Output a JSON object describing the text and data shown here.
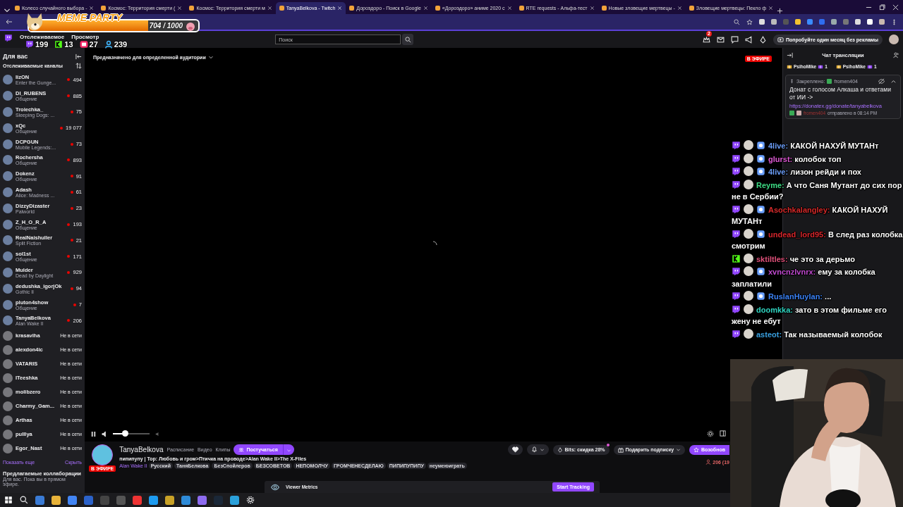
{
  "browser": {
    "tabs": [
      {
        "title": "Колесо случайного выбора -",
        "selected": false
      },
      {
        "title": "Космос: Территория смерти (",
        "selected": false
      },
      {
        "title": "Космос: Территория смерти м",
        "selected": false
      },
      {
        "title": "TanyaBelkova - Twitch",
        "selected": true
      },
      {
        "title": "Дороэдоро - Поиск в Google",
        "selected": false
      },
      {
        "title": "«Дороэдоро» аниме 2020 с",
        "selected": false
      },
      {
        "title": "RTE requests - Альфа-тест",
        "selected": false
      },
      {
        "title": "Новые зловещие мертвецы -",
        "selected": false
      },
      {
        "title": "Зловещие мертвецы: Пекло ф",
        "selected": false
      }
    ]
  },
  "meme_widget": {
    "title": "MEME PARTY",
    "level": 0.704,
    "reading": "704 / 1000"
  },
  "stream_counters": [
    {
      "kind": "twitch",
      "count": "199"
    },
    {
      "kind": "kick",
      "count": "13"
    },
    {
      "kind": "vklive",
      "count": "27"
    },
    {
      "kind": "total",
      "count": "239"
    }
  ],
  "nav": {
    "links": [
      "Отслеживаемое",
      "Просмотр"
    ],
    "search": {
      "placeholder": "Поиск"
    },
    "notification_count": "2",
    "promo_button": "Попробуйте один месяц без рекламы"
  },
  "sidebar": {
    "title": "Для вас",
    "section": "Отслеживаемые каналы",
    "channels": [
      {
        "name": "lizON",
        "game": "Enter the Gunge...",
        "viewers": "494",
        "live": true
      },
      {
        "name": "DI_RUBENS",
        "game": "Общение",
        "viewers": "885",
        "live": true
      },
      {
        "name": "Troiechka_",
        "game": "Sleeping Dogs: ...",
        "viewers": "75",
        "live": true
      },
      {
        "name": "xQc",
        "game": "Общение",
        "viewers": "19 077",
        "live": true
      },
      {
        "name": "DCPGUN",
        "game": "Mobile Legends:...",
        "viewers": "73",
        "live": true
      },
      {
        "name": "Rochersha",
        "game": "Общение",
        "viewers": "893",
        "live": true
      },
      {
        "name": "Dokenz",
        "game": "Общение",
        "viewers": "91",
        "live": true
      },
      {
        "name": "Adash",
        "game": "Alice: Madness ...",
        "viewers": "61",
        "live": true
      },
      {
        "name": "DizzyDizaster",
        "game": "Palworld",
        "viewers": "23",
        "live": true
      },
      {
        "name": "Z_H_O_R_A",
        "game": "Общение",
        "viewers": "193",
        "live": true
      },
      {
        "name": "RealNaishuller",
        "game": "Split Fiction",
        "viewers": "21",
        "live": true
      },
      {
        "name": "sol1st",
        "game": "Общение",
        "viewers": "171",
        "live": true
      },
      {
        "name": "Mulder",
        "game": "Dead by Daylight",
        "viewers": "929",
        "live": true
      },
      {
        "name": "dedushka_igorjOk",
        "game": "Gothic II",
        "viewers": "94",
        "live": true
      },
      {
        "name": "pluton4show",
        "game": "Общение",
        "viewers": "7",
        "live": true
      },
      {
        "name": "TanyaBelkova",
        "game": "Alan Wake II",
        "viewers": "206",
        "live": true
      },
      {
        "name": "krasaviha",
        "status": "Не в сети",
        "live": false
      },
      {
        "name": "alexdon4ic",
        "status": "Не в сети",
        "live": false
      },
      {
        "name": "VATARIS",
        "status": "Не в сети",
        "live": false
      },
      {
        "name": "ITeeshka",
        "status": "Не в сети",
        "live": false
      },
      {
        "name": "molibzero",
        "status": "Не в сети",
        "live": false
      },
      {
        "name": "Charmy_Gam...",
        "status": "Не в сети",
        "live": false
      },
      {
        "name": "Arthas",
        "status": "Не в сети",
        "live": false
      },
      {
        "name": "pulllya",
        "status": "Не в сети",
        "live": false
      },
      {
        "name": "Egor_Nast",
        "status": "Не в сети",
        "live": false
      }
    ],
    "show_more": "Показать еще",
    "hide": "Скрыть",
    "suggest_title": "Предлагаемые коллаборации",
    "suggest_text": "Для вас. Пока вы в прямом эфире."
  },
  "player": {
    "audience": "Предназначено для определенной аудитории",
    "live_badge": "В ЭФИРЕ",
    "volume": {
      "level": 0.33
    }
  },
  "stream_info": {
    "channel": "TanyaBelkova",
    "links": [
      "Расписание",
      "Видео",
      "Клипы"
    ],
    "knock_button": "Постучаться",
    "title": "пипипупу | Тор: Любовь и гром>Птичка на проводе>Alan Wake II>The X-Files",
    "live_badge": "В ЭФИРЕ",
    "game": "Alan Wake II",
    "tags": [
      "Русский",
      "ТаняБелкова",
      "БезСпойлеров",
      "БЕЗСОВЕТОВ",
      "НЕПОМОЛЧУ",
      "ГРОМЧЕНЕСДЕЛАЮ",
      "ПИПИПУПИПУ",
      "неумеюиграть"
    ],
    "bits_button": "Bits: скидка 28%",
    "gift_button": "Подарить подписку",
    "resume_button": "Возобнов",
    "viewers": "206 (19"
  },
  "viewer_metrics": {
    "title": "Viewer Metrics",
    "button": "Start Tracking"
  },
  "chat": {
    "title": "Чат трансляции",
    "gifts": [
      {
        "user": "PsihoMike",
        "count": "1"
      },
      {
        "user": "PsihoMike",
        "count": "1"
      }
    ],
    "pinned": {
      "label": "Закреплено:",
      "author": "fromen404",
      "text": "Донат с голосом Алкаша и ответами от ИИ ->",
      "link": "https://donatex.gg/donate/tanyabelkova",
      "sender": "fromen404",
      "sent": "отправлено в 08:14 PM"
    }
  },
  "stream_chat": [
    {
      "kind": "twitch",
      "badge": true,
      "user": "4live:",
      "color": "#6a9cf5",
      "message": "КАКОЙ НАХУЙ МУТАНт"
    },
    {
      "kind": "twitch",
      "badge": true,
      "user": "glurst:",
      "color": "#e05ad6",
      "message": "колобок топ"
    },
    {
      "kind": "twitch",
      "badge": true,
      "user": "4live:",
      "color": "#6a9cf5",
      "message": "лизон рейди и пох"
    },
    {
      "kind": "twitch",
      "badge": false,
      "user": "Reyme:",
      "color": "#3ddc84",
      "message": "А что Саня Мутант до сих пор не в Сербии?"
    },
    {
      "kind": "twitch",
      "badge": true,
      "user": "Asochkalangley:",
      "color": "#d62a2a",
      "message": "КАКОЙ НАХУЙ МУТАНт"
    },
    {
      "kind": "twitch",
      "badge": true,
      "user": "undead_lord95:",
      "color": "#d8262c",
      "message": "В след раз колобка смотрим"
    },
    {
      "kind": "kick",
      "badge": false,
      "user": "sktiltles:",
      "color": "#e0507a",
      "message": "че это за дерьмо"
    },
    {
      "kind": "twitch",
      "badge": true,
      "user": "xvncnzlvnrx:",
      "color": "#c04ad0",
      "message": "ему за колобка заплатили"
    },
    {
      "kind": "twitch",
      "badge": true,
      "user": "RuslanHuylan:",
      "color": "#3b82f6",
      "message": "..."
    },
    {
      "kind": "twitch",
      "badge": false,
      "user": "doomkka:",
      "color": "#2fd4c0",
      "message": "зато в этом фильме его жену не ебут"
    },
    {
      "kind": "twitch",
      "badge": false,
      "user": "asteot:",
      "color": "#39a0e0",
      "message": "Так называемый колобок"
    }
  ]
}
